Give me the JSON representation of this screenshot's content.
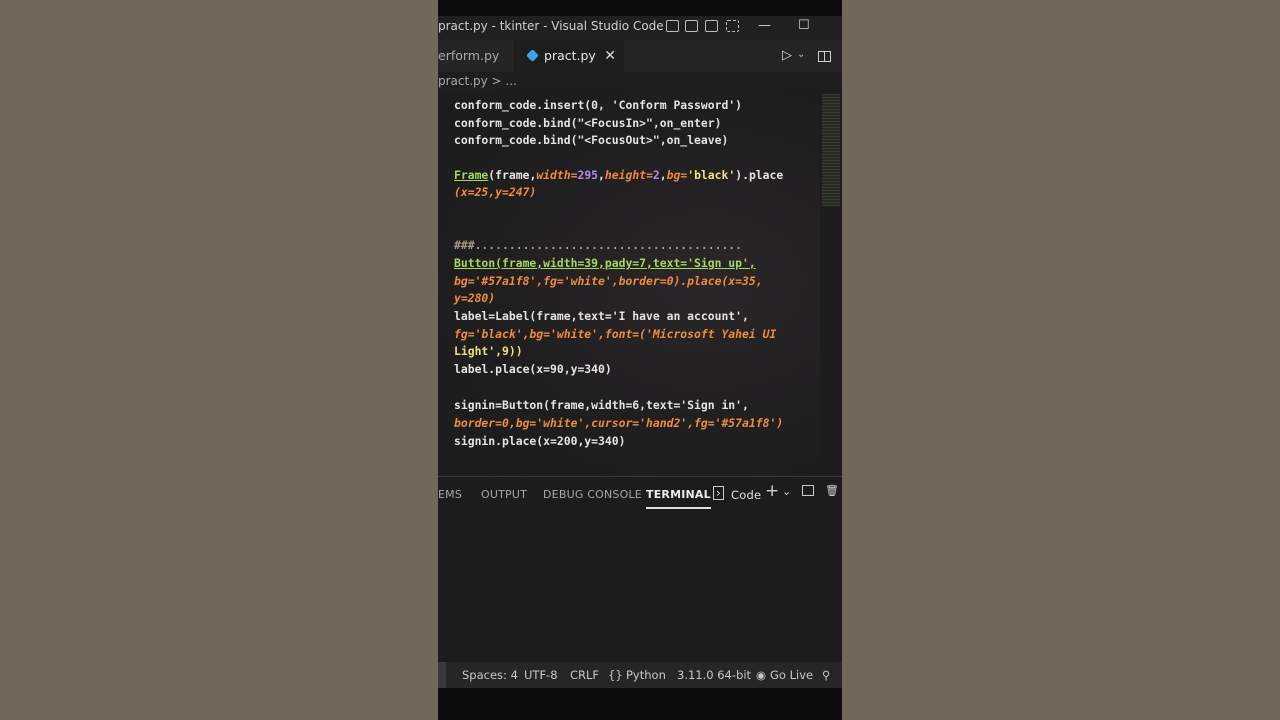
{
  "window": {
    "title": "pract.py - tkinter - Visual Studio Code",
    "minimize": "—",
    "maximize": "☐"
  },
  "tabs": [
    {
      "label": "erform.py"
    },
    {
      "label": "pract.py",
      "close": "✕"
    }
  ],
  "breadcrumb": "pract.py > ...",
  "editor_lines": {
    "l1": "conform_code.insert(0, 'Conform Password')",
    "l2": "conform_code.bind(\"<FocusIn>\",on_enter)",
    "l3": "conform_code.bind(\"<FocusOut>\",on_leave)",
    "l4_a": "Frame",
    "l4_b": "(frame,",
    "l4_c": "width",
    "l4_d": "=",
    "l4_e": "295",
    "l4_f": ",",
    "l4_g": "height",
    "l4_h": "=",
    "l4_i": "2",
    "l4_j": ",",
    "l4_k": "bg",
    "l4_l": "=",
    "l4_m": "'black'",
    "l4_n": ").place",
    "l5": "(x=25,y=247)",
    "l6": "###.......................................",
    "l7": "Button(frame,width=39,pady=7,text='Sign up',",
    "l8": "bg='#57a1f8',fg='white',border=0).place(x=35,",
    "l9": "y=280)",
    "l10": "label=Label(frame,text='I have an account',",
    "l11": "fg='black',bg='white',font=('Microsoft Yahei UI",
    "l12": "Light',9))",
    "l13": "label.place(x=90,y=340)",
    "l14": "signin=Button(frame,width=6,text='Sign in',",
    "l15": "border=0,bg='white',cursor='hand2',fg='#57a1f8')",
    "l16": "signin.place(x=200,y=340)"
  },
  "panel": {
    "tabs": [
      "EMS",
      "OUTPUT",
      "DEBUG CONSOLE",
      "TERMINAL"
    ],
    "active_tab": "TERMINAL",
    "terminal_profile": "Code",
    "add": "+",
    "chevron": "⌄",
    "trash": "🗑"
  },
  "status": {
    "spaces": "Spaces: 4",
    "encoding": "UTF-8",
    "eol": "CRLF",
    "language": "Python",
    "interpreter": "3.11.0 64-bit",
    "golive": "Go Live"
  },
  "colors": {
    "accent_blue": "#3aa6e8",
    "class_green": "#a6d85c",
    "param_orange": "#f08c3c",
    "number_purple": "#b38cf0",
    "string_yellow": "#f0e17a"
  }
}
